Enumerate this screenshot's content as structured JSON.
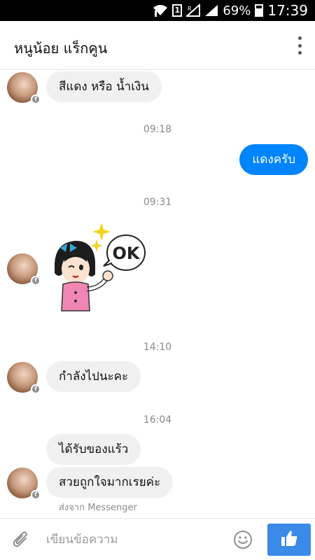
{
  "status_bar": {
    "sim": "1",
    "battery": "69%",
    "time": "17:39"
  },
  "header": {
    "title": "หนูน้อย แร็กคูน"
  },
  "messages": {
    "m1": "สีแดง หรือ น้ำเงิน",
    "t1": "09:18",
    "m2": "แดงครับ",
    "t2": "09:31",
    "sticker_text": "OK",
    "t3": "14:10",
    "m3": "กำลังไปนะคะ",
    "t4": "16:04",
    "m4": "ได้รับของแร้ว",
    "m5": "สวยถูกใจมากเรยค่ะ",
    "sent_from": "ส่งจาก Messenger"
  },
  "composer": {
    "placeholder": "เขียนข้อความ"
  },
  "colors": {
    "outgoing_bubble": "#0084ff",
    "incoming_bubble": "#f0f0f0",
    "like_button": "#3b8ae8"
  },
  "icons": [
    "wifi-icon",
    "signal-icon",
    "battery-icon",
    "more-options-icon",
    "facebook-badge-icon",
    "attach-icon",
    "emoji-icon",
    "thumbs-up-icon"
  ]
}
